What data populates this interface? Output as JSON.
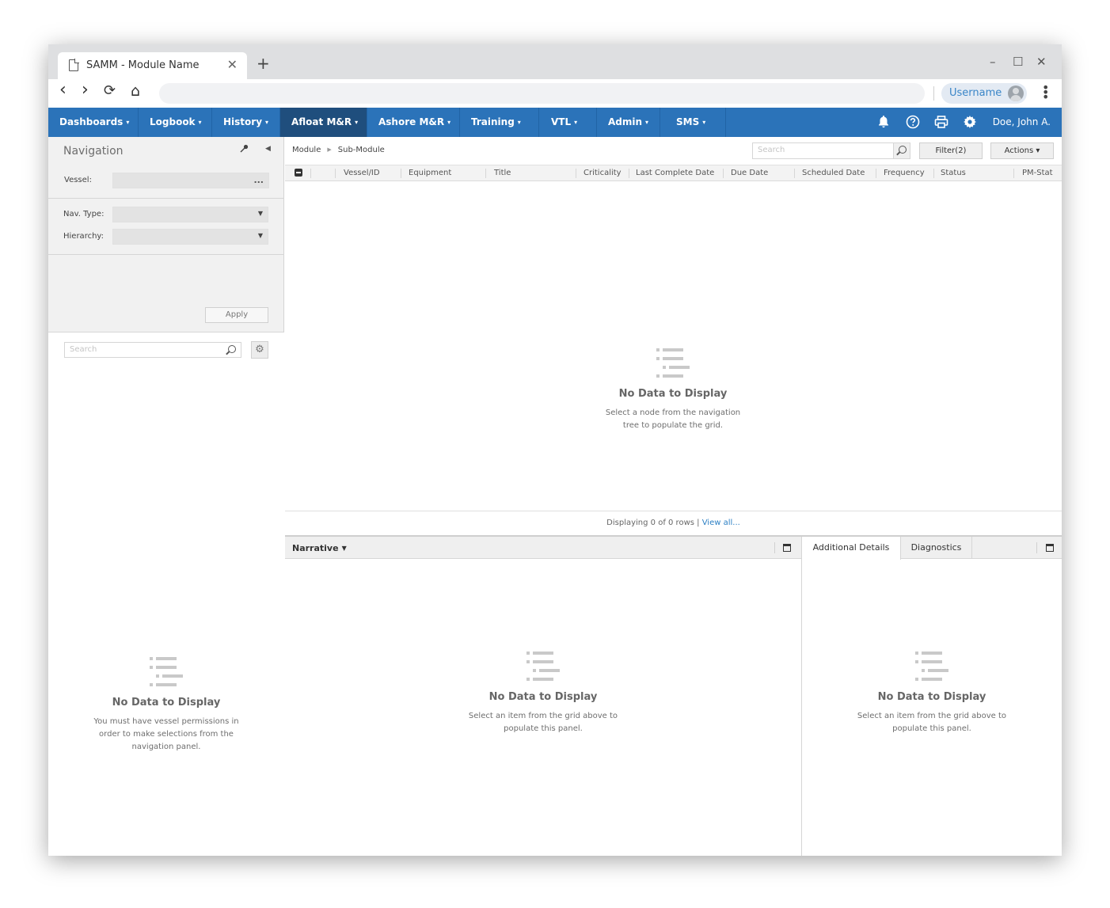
{
  "browser": {
    "tab_title": "SAMM - Module Name",
    "tab_close": "✕",
    "new_tab": "+",
    "minimize": "–",
    "maximize": "☐",
    "close": "✕",
    "back": "‹",
    "forward": "›",
    "reload": "⟳",
    "home": "⌂",
    "url": "",
    "user_label": "Username"
  },
  "nav": {
    "items": [
      {
        "label": "Dashboards",
        "active": false
      },
      {
        "label": "Logbook",
        "active": false
      },
      {
        "label": "History",
        "active": false
      },
      {
        "label": "Afloat M&R",
        "active": true
      },
      {
        "label": "Ashore M&R",
        "active": false
      },
      {
        "label": "Training",
        "active": false
      },
      {
        "label": "VTL",
        "active": false
      },
      {
        "label": "Admin",
        "active": false
      },
      {
        "label": "SMS",
        "active": false
      }
    ],
    "caret": "▾",
    "icons": [
      "bell-icon",
      "help-icon",
      "print-icon",
      "gear-icon"
    ],
    "user": "Doe, John A.",
    "colors": {
      "bar": "#2b73b9",
      "active": "#1f4e7d"
    }
  },
  "left": {
    "title": "Navigation",
    "vessel_label": "Vessel:",
    "vessel_more": "...",
    "navtype_label": "Nav. Type:",
    "hierarchy_label": "Hierarchy:",
    "apply": "Apply",
    "search_placeholder": "Search",
    "empty_title": "No Data to Display",
    "empty_text_1": "You must have vessel permissions in",
    "empty_text_2": "order to make selections from the",
    "empty_text_3": "navigation panel."
  },
  "main": {
    "breadcrumb": [
      "Module",
      "Sub-Module"
    ],
    "search_placeholder": "Search",
    "filter_button": "Filter(2)",
    "actions_button": "Actions ▾",
    "columns": [
      "Vessel/ID",
      "Equipment",
      "Title",
      "Criticality",
      "Last Complete Date",
      "Due Date",
      "Scheduled Date",
      "Frequency",
      "Status",
      "PM-Stat"
    ],
    "empty_title": "No Data to Display",
    "empty_text_1": "Select a node from the navigation",
    "empty_text_2": "tree to populate the grid.",
    "footer_text": "Displaying 0 of 0 rows | ",
    "footer_link": "View all..."
  },
  "narrative": {
    "title": "Narrative",
    "empty_title": "No Data to Display",
    "empty_text_1": "Select an item from the grid above to",
    "empty_text_2": "populate this panel."
  },
  "details": {
    "tabs": [
      "Additional Details",
      "Diagnostics"
    ],
    "empty_title": "No Data to Display",
    "empty_text_1": "Select an item from the grid above to",
    "empty_text_2": "populate this panel."
  }
}
